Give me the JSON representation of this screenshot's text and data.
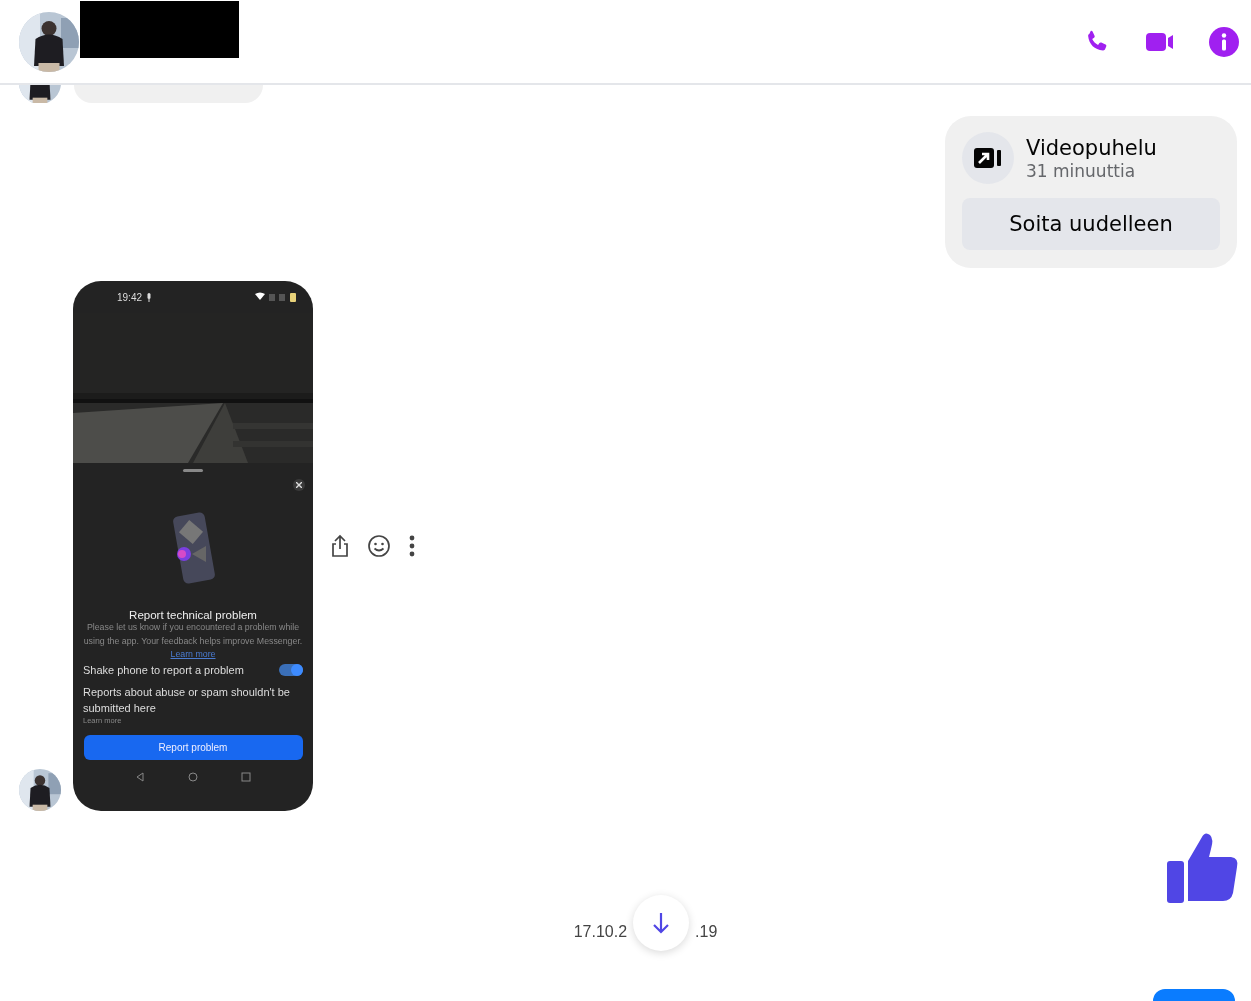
{
  "header": {
    "actions": [
      {
        "kind": "phone"
      },
      {
        "kind": "video"
      },
      {
        "kind": "info"
      }
    ]
  },
  "call_card": {
    "title": "Videopuhelu",
    "duration": "31 minuuttia",
    "button": "Soita uudelleen"
  },
  "screenshot": {
    "status_time": "19:42",
    "sheet_title": "Report technical problem",
    "sheet_text": "Please let us know if you encountered a problem while using the app. Your feedback helps improve Messenger.",
    "sheet_link": "Learn more",
    "toggle": {
      "label": "Shake phone to report a problem",
      "on": true
    },
    "notice": "Reports about abuse or spam shouldn't be submitted here",
    "notice_link": "Learn more",
    "button": "Report problem"
  },
  "message_actions": [
    {
      "kind": "share"
    },
    {
      "kind": "react"
    },
    {
      "kind": "more"
    }
  ],
  "timestamp": {
    "start": "17.10.2",
    "end": ".19"
  }
}
